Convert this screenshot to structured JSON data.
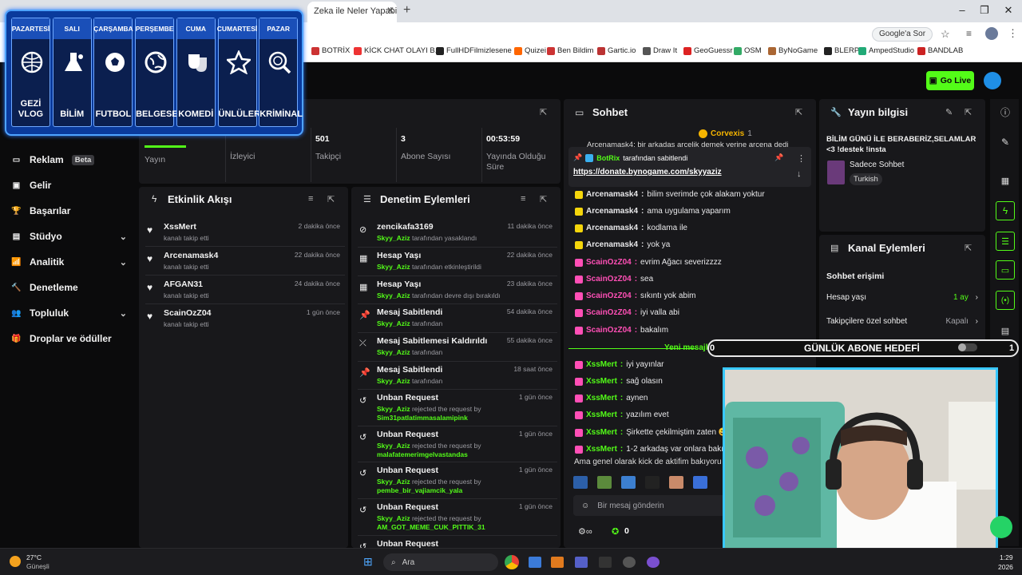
{
  "browser": {
    "tab_title": "Zeka ile Neler Yapabilirsi",
    "google_ask": "Google'a Sor",
    "bookmarks": [
      "BOTRİX",
      "KİCK CHAT OLAYI B...",
      "FullHDFilmizlesene",
      "Quizei",
      "Ben Bildim",
      "Gartic.io",
      "Draw It",
      "GeoGuessr",
      "OSM",
      "ByNoGame",
      "BLERP",
      "AmpedStudio",
      "BANDLAB"
    ]
  },
  "header": {
    "go_live": "Go Live"
  },
  "schedule": {
    "days": [
      {
        "day": "PAZARTESİ",
        "category": "GEZİ VLOG",
        "icon": "globe-plane-icon"
      },
      {
        "day": "SALI",
        "category": "BİLİM",
        "icon": "science-icon"
      },
      {
        "day": "ÇARŞAMBA",
        "category": "FUTBOL",
        "icon": "football-icon"
      },
      {
        "day": "PERŞEMBE",
        "category": "BELGESEL",
        "icon": "earth-icon"
      },
      {
        "day": "CUMA",
        "category": "KOMEDİ",
        "icon": "theater-masks-icon"
      },
      {
        "day": "CUMARTESİ",
        "category": "ÜNLÜLER",
        "icon": "star-icon"
      },
      {
        "day": "PAZAR",
        "category": "KRİMİNAL",
        "icon": "fingerprint-icon"
      }
    ]
  },
  "sidebar": {
    "items": [
      {
        "label": "Reklam",
        "badge": "Beta",
        "icon": "monitor-icon"
      },
      {
        "label": "Gelir",
        "icon": "wallet-icon"
      },
      {
        "label": "Başarılar",
        "icon": "trophy-icon"
      },
      {
        "label": "Stüdyo",
        "icon": "studio-icon",
        "chevron": true
      },
      {
        "label": "Analitik",
        "icon": "chart-icon",
        "chevron": true
      },
      {
        "label": "Denetleme",
        "icon": "hammer-icon"
      },
      {
        "label": "Topluluk",
        "icon": "community-icon",
        "chevron": true
      },
      {
        "label": "Droplar ve ödüller",
        "icon": "gift-icon"
      }
    ]
  },
  "stats": [
    {
      "value": "",
      "label": "Yayın"
    },
    {
      "value": "",
      "label": "İzleyici"
    },
    {
      "value": "501",
      "label": "Takipçi"
    },
    {
      "value": "3",
      "label": "Abone Sayısı"
    },
    {
      "value": "00:53:59",
      "label": "Yayında Olduğu Süre"
    }
  ],
  "activity": {
    "title": "Etkinlik Akışı",
    "items": [
      {
        "name": "XssMert",
        "sub": "kanalı takip etti",
        "time": "2 dakika önce"
      },
      {
        "name": "Arcenamask4",
        "sub": "kanalı takip etti",
        "time": "22 dakika önce"
      },
      {
        "name": "AFGAN31",
        "sub": "kanalı takip etti",
        "time": "24 dakika önce"
      },
      {
        "name": "ScainOzZ04",
        "sub": "kanalı takip etti",
        "time": "1 gün önce"
      }
    ]
  },
  "moderation": {
    "title": "Denetim Eylemleri",
    "items": [
      {
        "title": "zencikafa3169",
        "actor": "Skyy_Aziz",
        "rest": "tarafından yasaklandı",
        "target": "",
        "time": "11 dakika önce",
        "icon": "ban-icon"
      },
      {
        "title": "Hesap Yaşı",
        "actor": "Skyy_Aziz",
        "rest": "tarafından etkinleştirildi",
        "target": "",
        "time": "22 dakika önce",
        "icon": "calendar-icon"
      },
      {
        "title": "Hesap Yaşı",
        "actor": "Skyy_Aziz",
        "rest": "tarafından devre dışı bırakıldı",
        "target": "",
        "time": "23 dakika önce",
        "icon": "calendar-icon"
      },
      {
        "title": "Mesaj Sabitlendi",
        "actor": "Skyy_Aziz",
        "rest": "tarafından",
        "target": "",
        "time": "54 dakika önce",
        "icon": "pin-icon"
      },
      {
        "title": "Mesaj Sabitlemesi Kaldırıldı",
        "actor": "Skyy_Aziz",
        "rest": "tarafından",
        "target": "",
        "time": "55 dakika önce",
        "icon": "unpin-icon"
      },
      {
        "title": "Mesaj Sabitlendi",
        "actor": "Skyy_Aziz",
        "rest": "tarafından",
        "target": "",
        "time": "18 saat önce",
        "icon": "pin-icon"
      },
      {
        "title": "Unban Request",
        "actor": "Skyy_Aziz",
        "rest": "rejected the request by",
        "target": "Sim31patlatimmasalamipink",
        "time": "1 gün önce",
        "icon": "history-icon"
      },
      {
        "title": "Unban Request",
        "actor": "Skyy_Aziz",
        "rest": "rejected the request by",
        "target": "malafatemerimgelvastandas",
        "time": "1 gün önce",
        "icon": "history-icon"
      },
      {
        "title": "Unban Request",
        "actor": "Skyy_Aziz",
        "rest": "rejected the request by",
        "target": "pembe_bir_vajiamcik_yala",
        "time": "1 gün önce",
        "icon": "history-icon"
      },
      {
        "title": "Unban Request",
        "actor": "Skyy_Aziz",
        "rest": "rejected the request by",
        "target": "AM_GOT_MEME_CUK_PITTIK_31",
        "time": "1 gün önce",
        "icon": "history-icon"
      },
      {
        "title": "Unban Request",
        "actor": "",
        "rest": "",
        "target": "",
        "time": "",
        "icon": "history-icon"
      }
    ]
  },
  "chat": {
    "title": "Sohbet",
    "top_user": "Corvexis",
    "top_count": "1",
    "pinned_by": "BotRix",
    "pinned_action": "tarafından sabitlendi",
    "pinned_link": "https://donate.bynogame.com/skyyaziz",
    "top_cut": "Arcenamask4: bir arkadaş arcelik demek yerine arcena dedi",
    "new_messages": "Yeni mesajla",
    "messages": [
      {
        "user": "Arcenamask4",
        "text": "bilim sverimde çok alakam yoktur",
        "color": "#e8e8ea",
        "badge": "#f5d60b"
      },
      {
        "user": "Arcenamask4",
        "text": "ama uygulama yaparım",
        "color": "#e8e8ea",
        "badge": "#f5d60b"
      },
      {
        "user": "Arcenamask4",
        "text": "kodlama ile",
        "color": "#e8e8ea",
        "badge": "#f5d60b"
      },
      {
        "user": "Arcenamask4",
        "text": "yok ya",
        "color": "#e8e8ea",
        "badge": "#f5d60b"
      },
      {
        "user": "ScainOzZ04",
        "text": "evrim Ağacı severizzzz",
        "color": "#ff4fb6",
        "badge": "#ff4fb6"
      },
      {
        "user": "ScainOzZ04",
        "text": "sea",
        "color": "#ff4fb6",
        "badge": "#ff4fb6"
      },
      {
        "user": "ScainOzZ04",
        "text": "sıkıntı yok abim",
        "color": "#ff4fb6",
        "badge": "#ff4fb6"
      },
      {
        "user": "ScainOzZ04",
        "text": "iyi valla abi",
        "color": "#ff4fb6",
        "badge": "#ff4fb6"
      },
      {
        "user": "ScainOzZ04",
        "text": "bakalım",
        "color": "#ff4fb6",
        "badge": "#ff4fb6"
      },
      {
        "user": "XssMert",
        "text": "iyi yayınlar",
        "color": "#53fc18",
        "badge": "#ff4fb6"
      },
      {
        "user": "XssMert",
        "text": "sağ olasın",
        "color": "#53fc18",
        "badge": "#ff4fb6"
      },
      {
        "user": "XssMert",
        "text": "aynen",
        "color": "#53fc18",
        "badge": "#ff4fb6"
      },
      {
        "user": "XssMert",
        "text": "yazılım evet",
        "color": "#53fc18",
        "badge": "#ff4fb6"
      },
      {
        "user": "XssMert",
        "text": "Şirkette çekilmiştim zaten 😄",
        "color": "#53fc18",
        "badge": "#ff4fb6"
      },
      {
        "user": "XssMert",
        "text": "1-2 arkadaş var onlara bakıyo",
        "color": "#53fc18",
        "badge": "#ff4fb6"
      }
    ],
    "last_line": "Ama genel olarak kick de aktifim bakıyoru",
    "input_placeholder": "Bir mesaj gönderin",
    "footer_count": "0"
  },
  "stream_info": {
    "title": "Yayın bilgisi",
    "stream_title": "BİLİM GÜNÜ İLE BERABERİZ,SELAMLAR <3 !destek !insta",
    "category": "Sadece Sohbet",
    "language": "Turkish"
  },
  "channel_actions": {
    "title": "Kanal Eylemleri",
    "section": "Sohbet erişimi",
    "rows": [
      {
        "label": "Hesap yaşı",
        "value": "1 ay",
        "accent": true
      },
      {
        "label": "Takipçilere özel sohbet",
        "value": "Kapalı",
        "accent": false
      }
    ]
  },
  "goal": {
    "left": "0",
    "title": "GÜNLÜK ABONE HEDEFİ",
    "right": "1"
  },
  "taskbar": {
    "temp": "27°C",
    "weather": "Güneşli",
    "search": "Ara",
    "time": "1:29",
    "date": "2026"
  }
}
